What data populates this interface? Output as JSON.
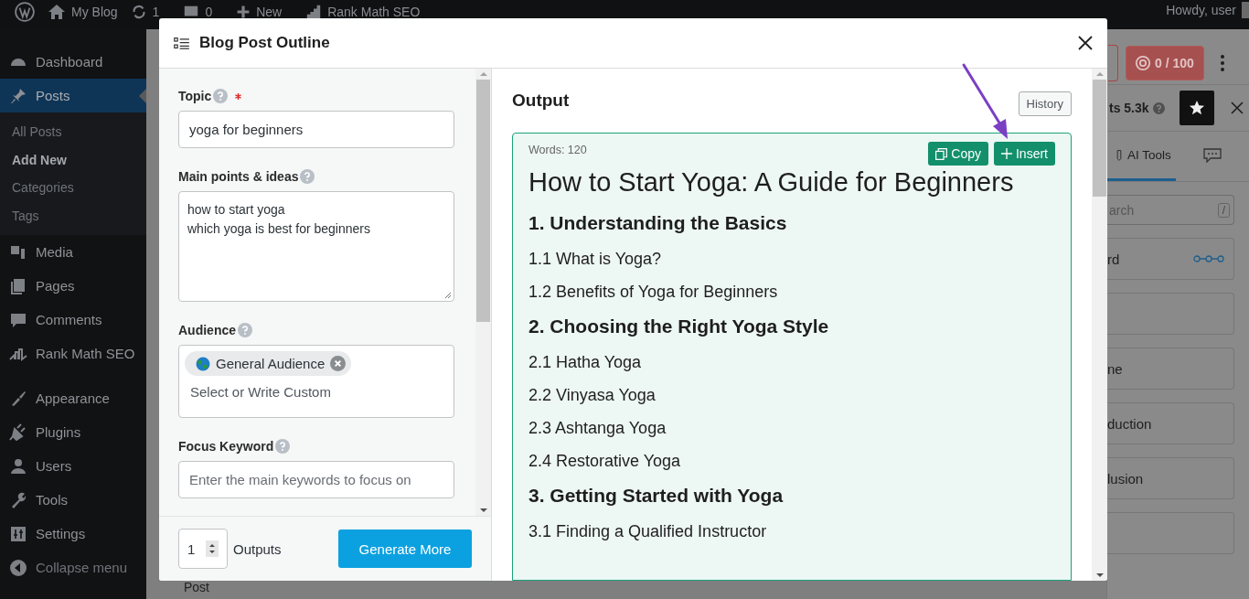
{
  "admin_bar": {
    "site": "My Blog",
    "updates": "1",
    "comments": "0",
    "new": "New",
    "seo": "Rank Math SEO",
    "greeting": "Howdy, user"
  },
  "sidebar": {
    "items": [
      {
        "label": "Dashboard",
        "kind": "dashboard",
        "selected": false
      },
      {
        "label": "Posts",
        "kind": "posts",
        "selected": true,
        "children": [
          {
            "label": "All Posts",
            "selected": false
          },
          {
            "label": "Add New",
            "selected": true
          },
          {
            "label": "Categories",
            "selected": false
          },
          {
            "label": "Tags",
            "selected": false
          }
        ]
      },
      {
        "label": "Media",
        "kind": "media",
        "selected": false
      },
      {
        "label": "Pages",
        "kind": "pages",
        "selected": false
      },
      {
        "label": "Comments",
        "kind": "comments",
        "selected": false
      },
      {
        "label": "Rank Math SEO",
        "kind": "seo",
        "selected": false
      },
      {
        "label": "Appearance",
        "kind": "appearance",
        "selected": false
      },
      {
        "label": "Plugins",
        "kind": "plugins",
        "selected": false
      },
      {
        "label": "Users",
        "kind": "users",
        "selected": false
      },
      {
        "label": "Tools",
        "kind": "tools",
        "selected": false
      },
      {
        "label": "Settings",
        "kind": "settings",
        "selected": false
      }
    ],
    "collapse": "Collapse menu"
  },
  "behind_text": "Post",
  "side_panel": {
    "score": "0 / 100",
    "posts": "ts 5.3k",
    "tabs": [
      {
        "label": "AI Tools",
        "kind": "tools",
        "selected": true
      },
      {
        "kind": "chat",
        "selected": false
      }
    ],
    "search_placeholder": "arch",
    "search_key": "/",
    "tools": [
      {
        "label": "rd",
        "kind": "connector"
      },
      {
        "kind": "blank"
      },
      {
        "label": "ne",
        "kind": "plain"
      },
      {
        "label": "duction",
        "kind": "plain"
      },
      {
        "label": "lusion",
        "kind": "plain"
      },
      {
        "kind": "blank"
      }
    ]
  },
  "modal": {
    "title": "Blog Post Outline",
    "form": {
      "fields": [
        {
          "label": "Topic",
          "kind": "input",
          "required": true,
          "value": "yoga for beginners"
        },
        {
          "label": "Main points & ideas",
          "kind": "textarea",
          "required": false,
          "value": "how to start yoga\nwhich yoga is best for beginners"
        },
        {
          "label": "Audience",
          "kind": "tags",
          "required": false,
          "tags": [
            "General Audience"
          ],
          "placeholder": "Select or Write Custom"
        },
        {
          "label": "Focus Keyword",
          "kind": "input",
          "required": false,
          "placeholder": "Enter the main keywords to focus on"
        }
      ],
      "outputs_value": "1",
      "outputs_label": "Outputs",
      "generate": "Generate More"
    },
    "output": {
      "heading": "Output",
      "history": "History",
      "words": "Words: 120",
      "copy": "Copy",
      "insert": "Insert",
      "blocks": [
        {
          "kind": "h1",
          "text": "How to Start Yoga: A Guide for Beginners"
        },
        {
          "kind": "h2",
          "text": "1. Understanding the Basics"
        },
        {
          "kind": "h3",
          "text": "1.1 What is Yoga?"
        },
        {
          "kind": "h3",
          "text": "1.2 Benefits of Yoga for Beginners"
        },
        {
          "kind": "h2",
          "text": "2. Choosing the Right Yoga Style"
        },
        {
          "kind": "h3",
          "text": "2.1 Hatha Yoga"
        },
        {
          "kind": "h3",
          "text": "2.2 Vinyasa Yoga"
        },
        {
          "kind": "h3",
          "text": "2.3 Ashtanga Yoga"
        },
        {
          "kind": "h3",
          "text": "2.4 Restorative Yoga"
        },
        {
          "kind": "h2",
          "text": "3. Getting Started with Yoga"
        },
        {
          "kind": "h3",
          "text": "3.1 Finding a Qualified Instructor"
        }
      ]
    }
  }
}
